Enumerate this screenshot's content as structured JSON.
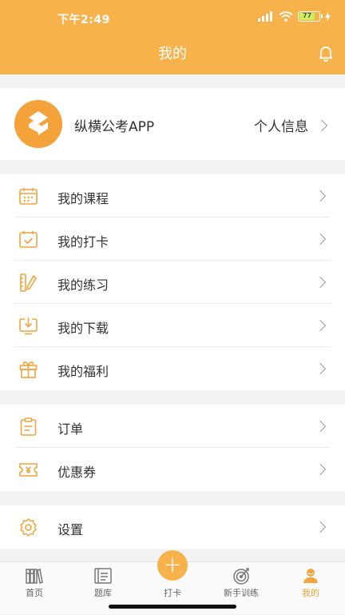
{
  "status": {
    "time": "下午2:49",
    "battery": "77"
  },
  "header": {
    "title": "我的"
  },
  "profile": {
    "name": "纵横公考APP",
    "link": "个人信息"
  },
  "group1": [
    {
      "label": "我的课程",
      "icon": "calendar-icon"
    },
    {
      "label": "我的打卡",
      "icon": "checkin-icon"
    },
    {
      "label": "我的练习",
      "icon": "pencil-ruler-icon"
    },
    {
      "label": "我的下载",
      "icon": "download-icon"
    },
    {
      "label": "我的福利",
      "icon": "gift-icon"
    }
  ],
  "group2": [
    {
      "label": "订单",
      "icon": "clipboard-icon"
    },
    {
      "label": "优惠券",
      "icon": "coupon-icon"
    }
  ],
  "group3": [
    {
      "label": "设置",
      "icon": "gear-icon"
    }
  ],
  "tabs": [
    {
      "label": "首页",
      "icon": "books-icon",
      "active": false
    },
    {
      "label": "题库",
      "icon": "question-bank-icon",
      "active": false
    },
    {
      "label": "打卡",
      "icon": "plus-icon",
      "active": false
    },
    {
      "label": "新手训练",
      "icon": "target-icon",
      "active": false
    },
    {
      "label": "我的",
      "icon": "user-icon",
      "active": true
    }
  ],
  "colors": {
    "accent": "#f8b24c",
    "icon": "#f3a33a",
    "background": "#f2f2f2"
  }
}
